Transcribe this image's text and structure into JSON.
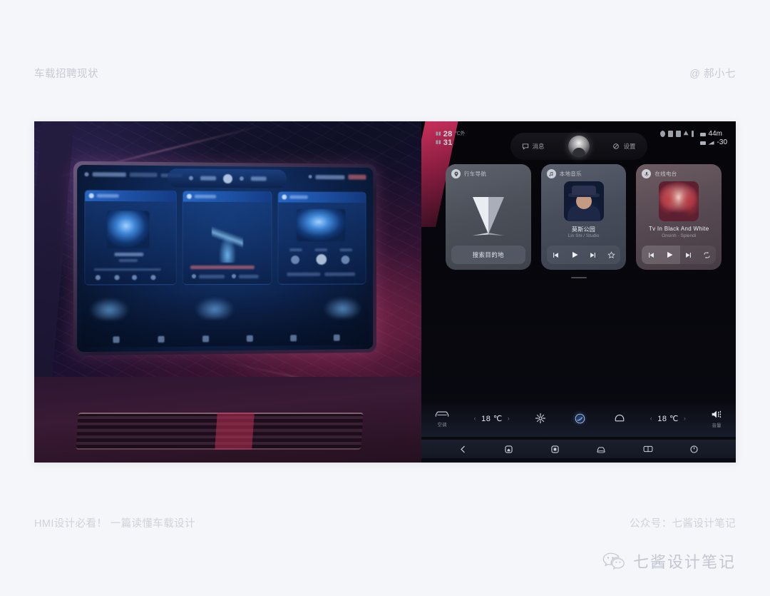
{
  "header": {
    "left_title": "车载招聘现状",
    "right_handle": "@ 郝小七"
  },
  "footer": {
    "left_caption": "HMI设计必看！ 一篇读懂车载设计",
    "right_caption": "公众号：七酱设计笔记",
    "brand_name": "七酱设计笔记",
    "brand_icon": "wechat-icon"
  },
  "photo": {
    "left_panel": {
      "name": "car-cockpit-photo",
      "description": "车载中控屏实拍",
      "tablet": {
        "card_count": 3
      }
    },
    "right_panel": {
      "name": "hmi-ui-mockup",
      "status_bar": {
        "outside_temp": "28",
        "inside_temp": "31",
        "range": "44m",
        "altitude": "-30",
        "left_icons": [
          "thermometer-icon",
          "thermometer-icon"
        ],
        "right_icons": [
          "bluetooth-icon",
          "battery-icon",
          "signal-icon",
          "wifi-icon",
          "menu-icon"
        ],
        "pill": {
          "left_label": "消息",
          "left_icon": "chat-bubble-icon",
          "right_label": "设置",
          "right_icon": "link-icon",
          "avatar": "user-avatar"
        }
      },
      "cards": [
        {
          "id": "navigation",
          "header_icon": "location-pin-icon",
          "header_label": "行车导航",
          "button_label": "搜索目的地",
          "graphic": "nav-arrow-3d"
        },
        {
          "id": "music",
          "header_icon": "music-note-icon",
          "header_label": "本地音乐",
          "title": "莫斯公园",
          "subtitle": "Lin Shi / Studio",
          "controls": [
            "previous-icon",
            "play-icon",
            "next-icon",
            "star-icon"
          ]
        },
        {
          "id": "radio",
          "header_icon": "podcast-icon",
          "header_label": "在线电台",
          "title": "Tv In Black And White",
          "subtitle": "Onsinh - Splendi",
          "controls": [
            "previous-icon",
            "play-icon",
            "next-icon",
            "repeat-icon"
          ]
        }
      ],
      "climate": {
        "left_label": "空调",
        "left_icon": "car-icon",
        "driver_temp": "18 ℃",
        "passenger_temp": "18 ℃",
        "unit": "℃",
        "center_icons": [
          "fan-icon",
          "auto-ac-icon",
          "seat-heat-icon"
        ],
        "right_label": "音量",
        "right_icon": "volume-icon"
      },
      "navbar": {
        "items": [
          "back-icon",
          "home-icon",
          "recents-icon",
          "car-360-icon",
          "split-screen-icon",
          "power-icon"
        ]
      }
    }
  },
  "colors": {
    "page_background": "#f5f6fa",
    "muted_text": "#c6cad3",
    "footer_text": "#cfd2da",
    "photo_dark": "#05060d",
    "accent_red": "#c8305c",
    "cockpit_blue": "#143a74"
  }
}
